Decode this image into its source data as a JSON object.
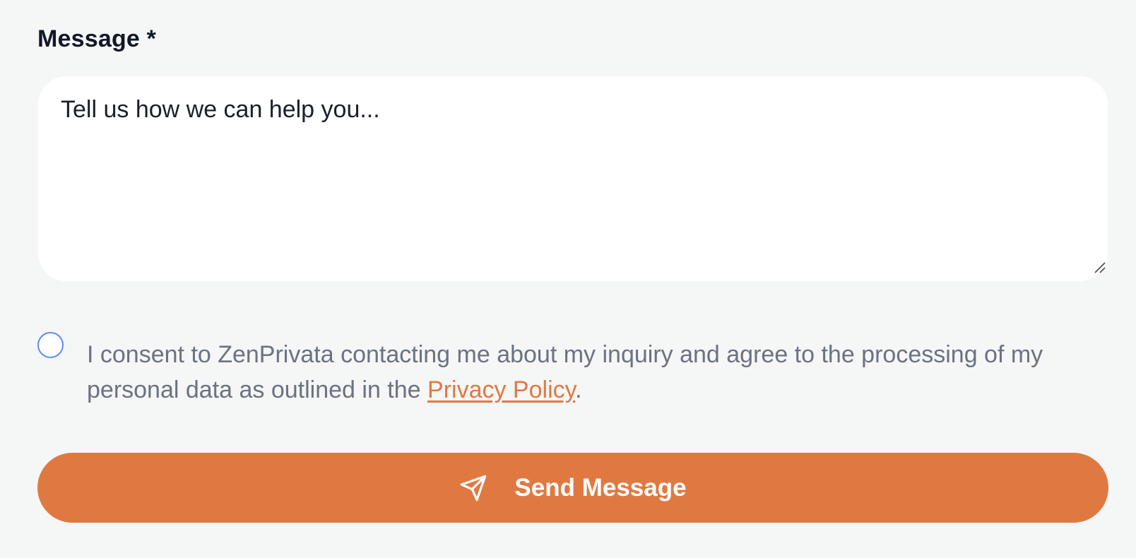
{
  "form": {
    "message_label": "Message *",
    "message_placeholder": "Tell us how we can help you...",
    "message_value": ""
  },
  "consent": {
    "checked": false,
    "text_before": "I consent to ZenPrivata contacting me about my inquiry and agree to the processing of my personal data as outlined in the ",
    "link_label": "Privacy Policy",
    "text_after": "."
  },
  "submit": {
    "label": "Send Message",
    "icon": "send-icon"
  },
  "colors": {
    "accent": "#e07941",
    "background": "#f5f6f6",
    "radio_border": "#5b8def",
    "muted_text": "#6b7280"
  }
}
